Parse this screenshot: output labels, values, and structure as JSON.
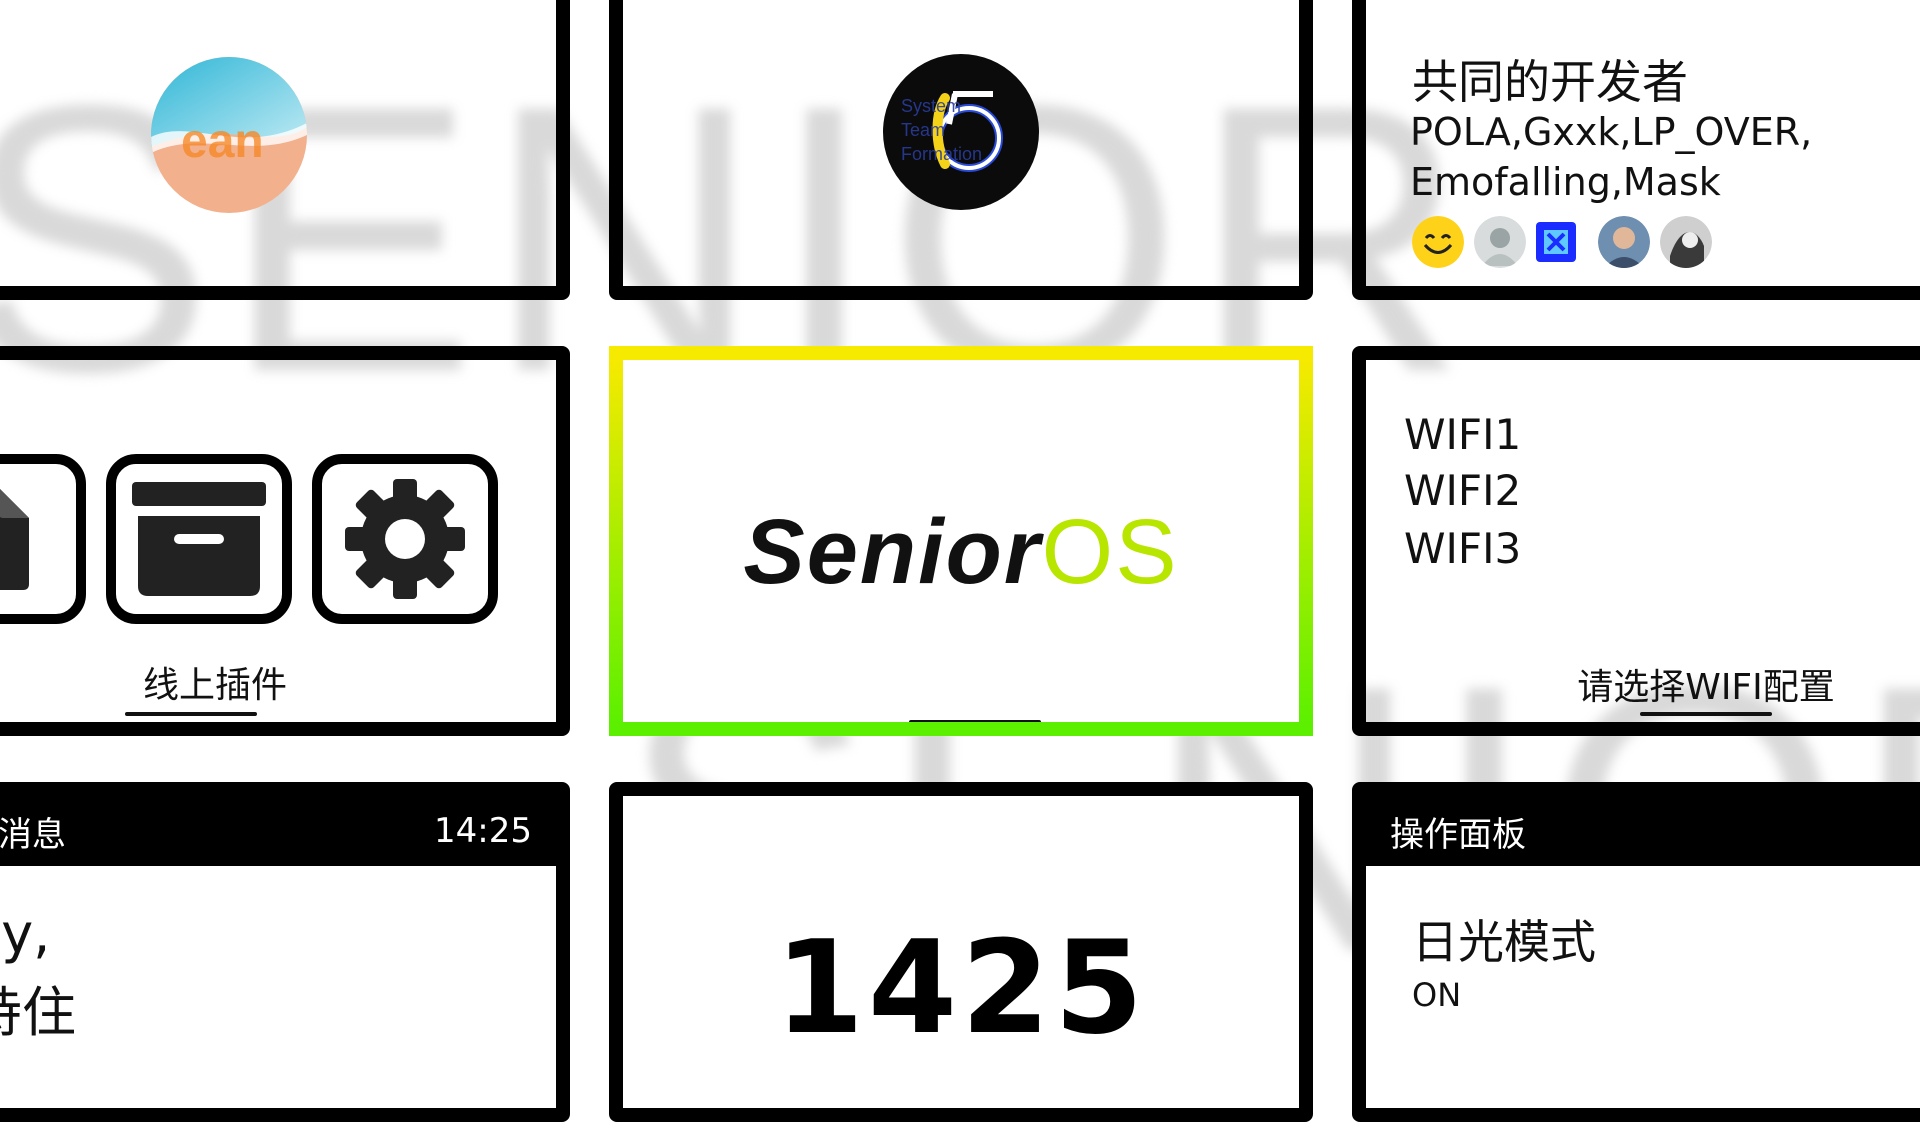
{
  "background_text": {
    "line1": "SENIOR",
    "line2": "SENIOR"
  },
  "developers": {
    "title": "共同的开发者",
    "names_line1": "POLA,Gxxk,LP_OVER,",
    "names_line2": "Emofalling,Mask",
    "avatar_count": 5
  },
  "logo_card": {
    "badge_text_lines": [
      "System",
      "Team",
      "Formation"
    ]
  },
  "plugins": {
    "label": "线上插件",
    "icons": [
      "file-icon",
      "archive-box-icon",
      "gear-icon"
    ]
  },
  "brand": {
    "text_dark": "Senior",
    "text_accent": "OS"
  },
  "wifi": {
    "networks": [
      "WIFI1",
      "WIFI2",
      "WIFI3"
    ],
    "prompt": "请选择WIFI配置"
  },
  "messages": {
    "header_title": "消息",
    "header_time": "14:25",
    "body_line1": "ey,",
    "body_line2": "持住"
  },
  "clock": {
    "time": "1425"
  },
  "control_panel": {
    "header_title": "操作面板",
    "mode_label": "日光模式",
    "mode_state": "ON"
  },
  "colors": {
    "accent_yellow": "#f6ea00",
    "accent_green": "#5cf000",
    "card_border": "#000000"
  }
}
